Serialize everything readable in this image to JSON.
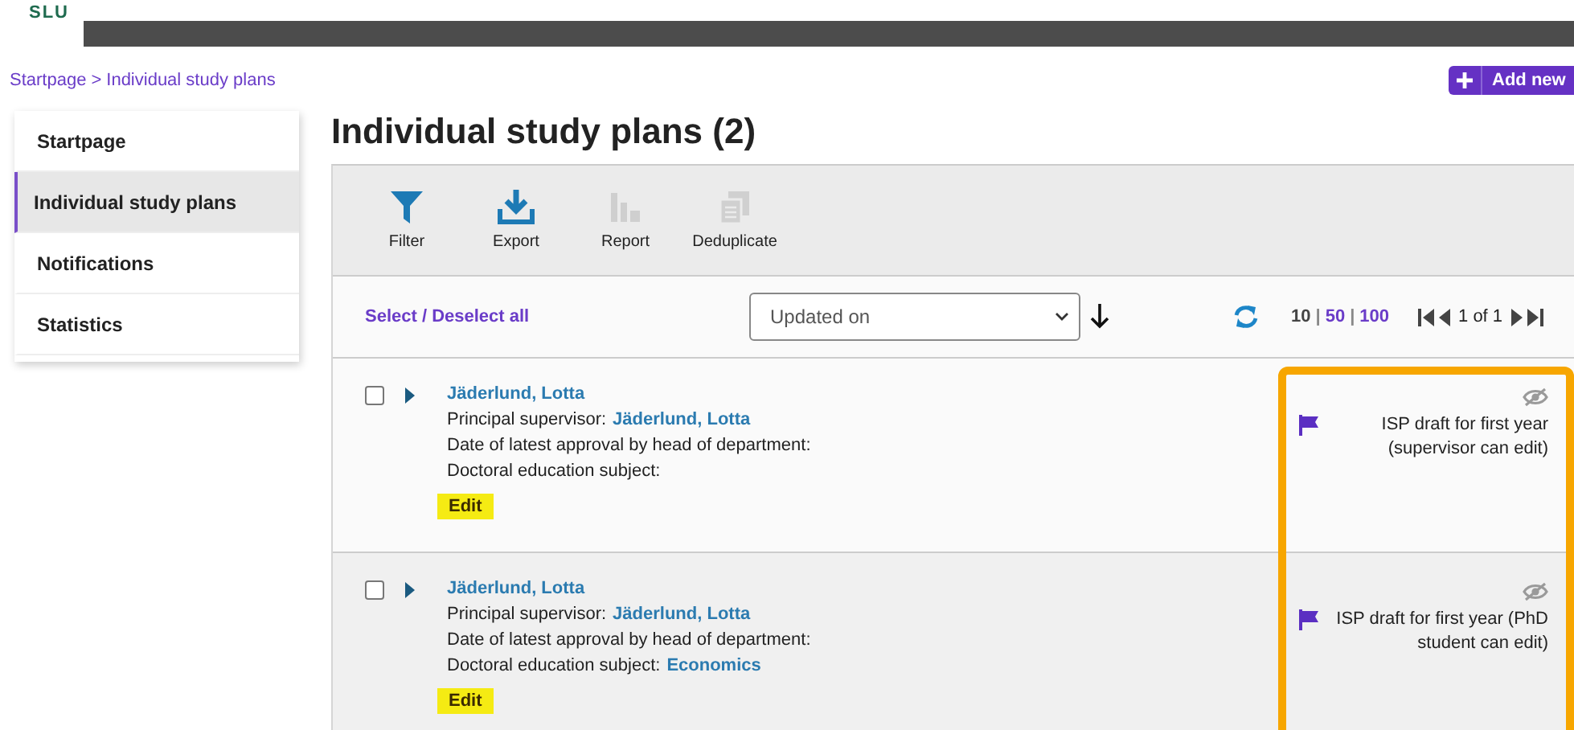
{
  "header": {
    "logo": "SLU"
  },
  "breadcrumb": {
    "items": [
      "Startpage",
      "Individual study plans"
    ],
    "separator": ">"
  },
  "add_button": {
    "label": "Add new"
  },
  "sidebar": {
    "items": [
      {
        "label": "Startpage",
        "selected": false
      },
      {
        "label": "Individual study plans",
        "selected": true
      },
      {
        "label": "Notifications",
        "selected": false
      },
      {
        "label": "Statistics",
        "selected": false
      }
    ]
  },
  "title": "Individual study plans (2)",
  "toolbar": [
    {
      "kind": "filter",
      "label": "Filter",
      "disabled": false
    },
    {
      "kind": "export",
      "label": "Export",
      "disabled": false
    },
    {
      "kind": "report",
      "label": "Report",
      "disabled": true
    },
    {
      "kind": "deduplicate",
      "label": "Deduplicate",
      "disabled": true
    }
  ],
  "select_all": "Select / Deselect all",
  "sort": {
    "value": "Updated on"
  },
  "page_size_separator": "|",
  "page_sizes": [
    {
      "label": "10",
      "selected": true
    },
    {
      "label": "50",
      "selected": false
    },
    {
      "label": "100",
      "selected": false
    }
  ],
  "pager": {
    "text": "1 of 1"
  },
  "records": [
    {
      "checked": false,
      "name": "Jäderlund, Lotta",
      "fields": [
        {
          "label": "Principal supervisor:",
          "value": "Jäderlund, Lotta"
        },
        {
          "label": "Date of latest approval by head of department:"
        },
        {
          "label": "Doctoral education subject:"
        }
      ],
      "edit": {
        "label": "Edit",
        "highlighted": true
      },
      "status": "ISP draft for first year (supervisor can edit)"
    },
    {
      "checked": false,
      "name": "Jäderlund, Lotta",
      "fields": [
        {
          "label": "Principal supervisor:",
          "value": "Jäderlund, Lotta"
        },
        {
          "label": "Date of latest approval by head of department:"
        },
        {
          "label": "Doctoral education subject:",
          "value": "Economics"
        }
      ],
      "edit": {
        "label": "Edit",
        "highlighted": true
      },
      "status": "ISP draft for first year (PhD student can edit)"
    }
  ]
}
